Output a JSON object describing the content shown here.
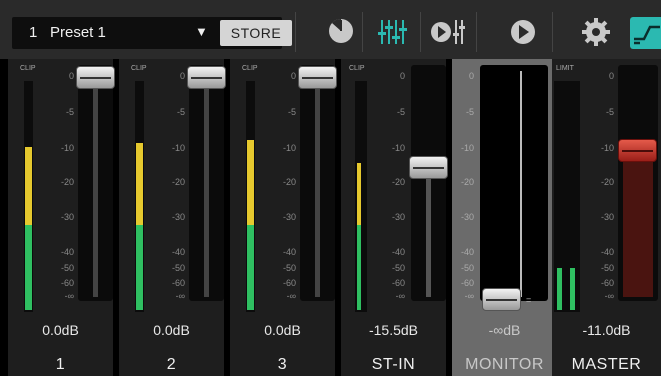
{
  "preset": {
    "number": "1",
    "name": "Preset 1",
    "arrow": "▼",
    "store_label": "STORE"
  },
  "toolbar_icons": [
    "level-meter-icon",
    "mixer-faders-icon",
    "play-fader-icon",
    "play-icon",
    "gear-icon",
    "routing-icon"
  ],
  "colors": {
    "accent": "#2bb9b1",
    "meter_green": "#2fbf61",
    "meter_yellow": "#e6c92e",
    "fader_red": "#c0322a"
  },
  "scale": [
    "0",
    "-5",
    "-10",
    "-20",
    "-30",
    "-40",
    "-50",
    "-60",
    "-∞"
  ],
  "channels": [
    {
      "name": "1",
      "db": "0.0dB",
      "clip_label": "CLIP",
      "meter_green": 0.37,
      "meter_yellow": 0.34,
      "fader_level": 1.0
    },
    {
      "name": "2",
      "db": "0.0dB",
      "clip_label": "CLIP",
      "meter_green": 0.37,
      "meter_yellow": 0.36,
      "fader_level": 1.0
    },
    {
      "name": "3",
      "db": "0.0dB",
      "clip_label": "CLIP",
      "meter_green": 0.37,
      "meter_yellow": 0.37,
      "fader_level": 1.0
    },
    {
      "name": "ST-IN",
      "db": "-15.5dB",
      "clip_label": "CLIP",
      "meter_green": 0.37,
      "meter_yellow": 0.27,
      "fader_level": 0.64
    },
    {
      "name": "MONITOR",
      "db": "-∞dB",
      "clip_label": "",
      "meter_green": 0,
      "meter_yellow": 0,
      "fader_level": 0.0
    },
    {
      "name": "MASTER",
      "db": "-11.0dB",
      "clip_label": "LIMIT",
      "meter_green": 0.18,
      "meter_yellow": 0,
      "fader_level": 0.72
    }
  ]
}
